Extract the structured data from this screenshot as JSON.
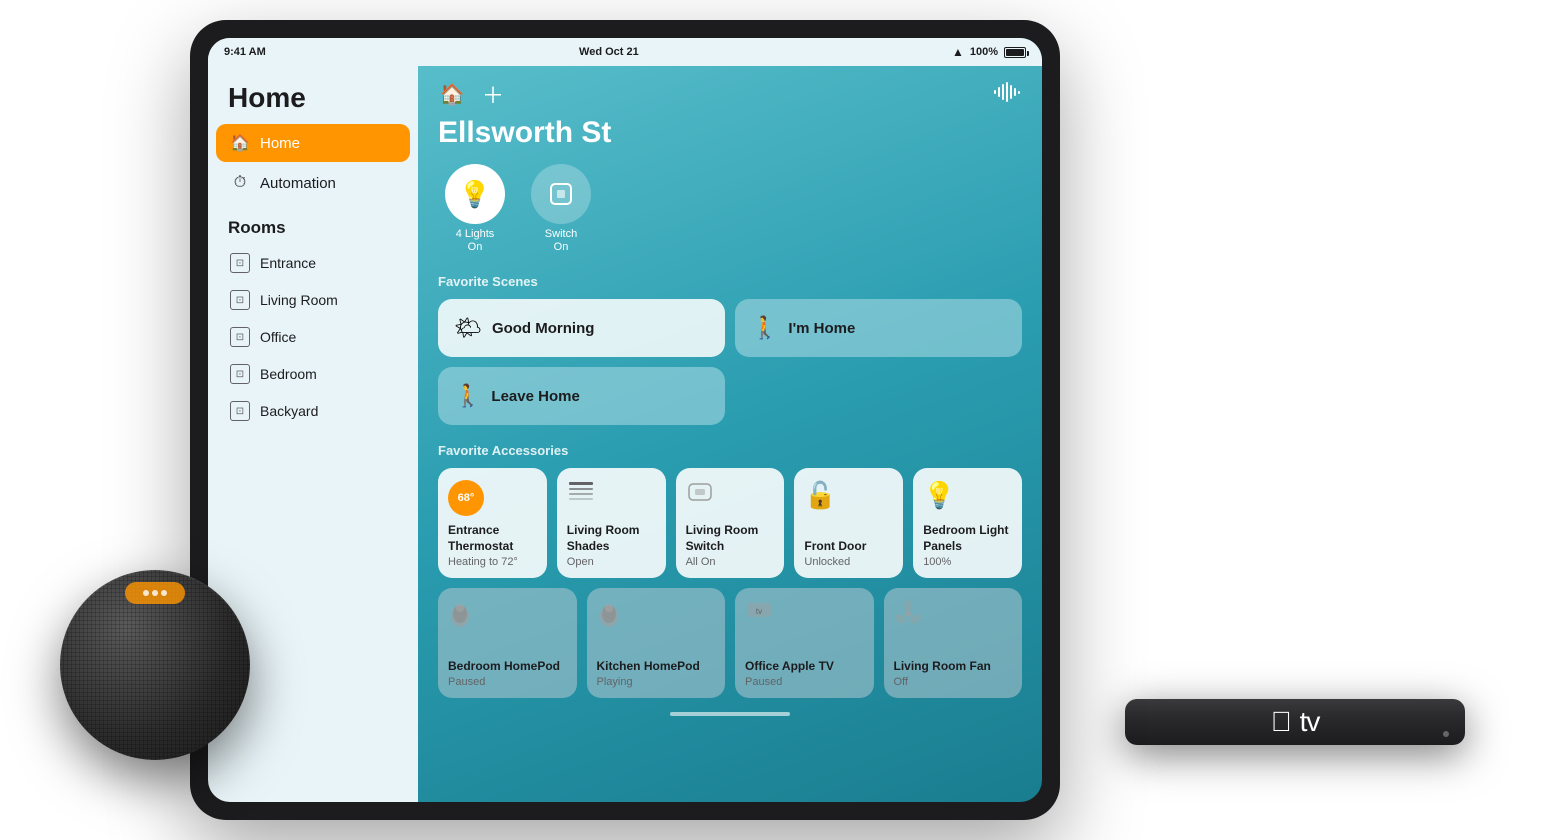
{
  "statusBar": {
    "time": "9:41 AM",
    "date": "Wed Oct 21",
    "battery": "100%"
  },
  "sidebar": {
    "title": "Home",
    "navItems": [
      {
        "id": "home",
        "label": "Home",
        "icon": "🏠",
        "active": true
      },
      {
        "id": "automation",
        "label": "Automation",
        "icon": "⏱",
        "active": false
      }
    ],
    "roomsTitle": "Rooms",
    "rooms": [
      {
        "label": "Entrance"
      },
      {
        "label": "Living Room"
      },
      {
        "label": "Office"
      },
      {
        "label": "Bedroom"
      },
      {
        "label": "Backyard"
      }
    ]
  },
  "main": {
    "homeName": "Ellsworth St",
    "quickTiles": [
      {
        "id": "lights",
        "label": "4 Lights\nOn",
        "icon": "💡",
        "active": true
      },
      {
        "id": "switch",
        "label": "Switch\nOn",
        "icon": "⬜",
        "active": false
      }
    ],
    "favoriteScenesLabel": "Favorite Scenes",
    "scenes": [
      {
        "id": "good-morning",
        "label": "Good Morning",
        "icon": "☀️",
        "style": "white"
      },
      {
        "id": "im-home",
        "label": "I'm Home",
        "icon": "🚶",
        "style": "tinted"
      },
      {
        "id": "leave-home",
        "label": "Leave Home",
        "icon": "🚶",
        "style": "tinted"
      }
    ],
    "favoriteAccessoriesLabel": "Favorite Accessories",
    "accessories": [
      {
        "id": "entrance-thermostat",
        "name": "Entrance Thermostat",
        "status": "Heating to 72°",
        "icon": "thermo",
        "badge": "68°",
        "style": "white"
      },
      {
        "id": "living-room-shades",
        "name": "Living Room Shades",
        "status": "Open",
        "icon": "≡",
        "style": "white"
      },
      {
        "id": "living-room-switch",
        "name": "Living Room Switch",
        "status": "All On",
        "icon": "▭",
        "style": "white"
      },
      {
        "id": "front-door",
        "name": "Front Door",
        "status": "Unlocked",
        "icon": "🔓",
        "style": "white"
      },
      {
        "id": "bedroom-light-panels",
        "name": "Bedroom Light Panels",
        "status": "100%",
        "icon": "💡",
        "style": "white"
      }
    ],
    "accessories2": [
      {
        "id": "bedroom-homepod",
        "name": "Bedroom HomePod",
        "status": "Paused",
        "icon": "🔊",
        "style": "gray"
      },
      {
        "id": "kitchen-homepod",
        "name": "Kitchen HomePod",
        "status": "Playing",
        "icon": "🔊",
        "style": "gray"
      },
      {
        "id": "office-apple-tv",
        "name": "Office Apple TV",
        "status": "Paused",
        "icon": "tv",
        "style": "gray"
      },
      {
        "id": "living-room-fan",
        "name": "Living Room Fan",
        "status": "Off",
        "icon": "🌀",
        "style": "gray"
      }
    ]
  }
}
